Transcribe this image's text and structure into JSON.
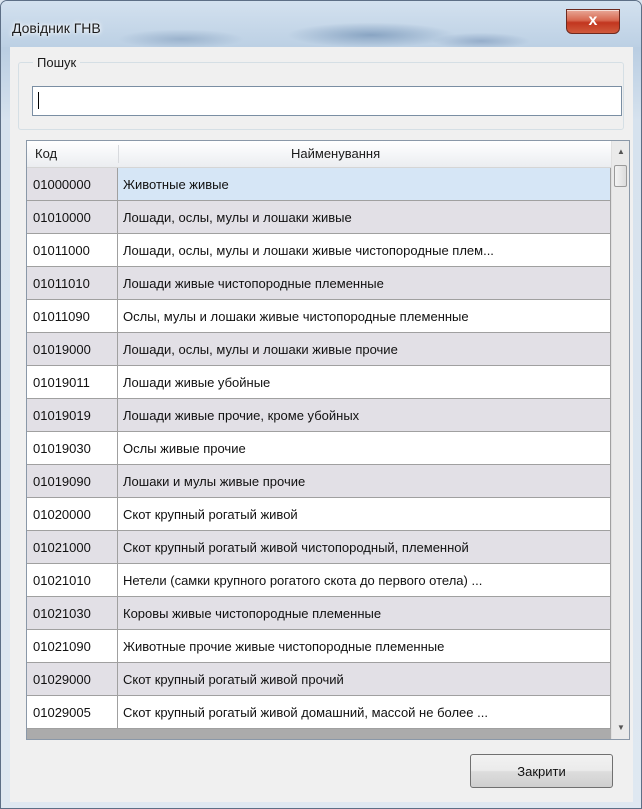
{
  "window": {
    "title": "Довідник ГНВ",
    "close_glyph": "x"
  },
  "search": {
    "legend": "Пошук",
    "value": ""
  },
  "table": {
    "headers": {
      "code": "Код",
      "name": "Найменування"
    },
    "rows": [
      {
        "code": "01000000",
        "name": "Животные живые"
      },
      {
        "code": "01010000",
        "name": "Лошади, ослы, мулы и лошаки живые"
      },
      {
        "code": "01011000",
        "name": "Лошади, ослы, мулы и лошаки живые чистопородные плем..."
      },
      {
        "code": "01011010",
        "name": "Лошади живые чистопородные племенные"
      },
      {
        "code": "01011090",
        "name": "Ослы, мулы и лошаки живые чистопородные племенные"
      },
      {
        "code": "01019000",
        "name": "Лошади, ослы, мулы и лошаки живые прочие"
      },
      {
        "code": "01019011",
        "name": "Лошади живые убойные"
      },
      {
        "code": "01019019",
        "name": "Лошади живые прочие, кроме убойных"
      },
      {
        "code": "01019030",
        "name": "Ослы живые прочие"
      },
      {
        "code": "01019090",
        "name": "Лошаки и мулы живые прочие"
      },
      {
        "code": "01020000",
        "name": "Скот крупный рогатый живой"
      },
      {
        "code": "01021000",
        "name": "Скот крупный рогатый живой чистопородный, племенной"
      },
      {
        "code": "01021010",
        "name": "Нетели (самки крупного рогатого скота до первого отела) ..."
      },
      {
        "code": "01021030",
        "name": "Коровы живые чистопородные племенные"
      },
      {
        "code": "01021090",
        "name": "Животные прочие живые чистопородные племенные"
      },
      {
        "code": "01029000",
        "name": "Скот крупный рогатый живой прочий"
      },
      {
        "code": "01029005",
        "name": "Скот крупный рогатый живой домашний, массой не более ..."
      }
    ],
    "selected_index": 0
  },
  "footer": {
    "close_label": "Закрити"
  },
  "colors": {
    "selected_row": "#d6e6f6",
    "even_row": "#e2e0e6",
    "odd_row": "#ffffff"
  }
}
